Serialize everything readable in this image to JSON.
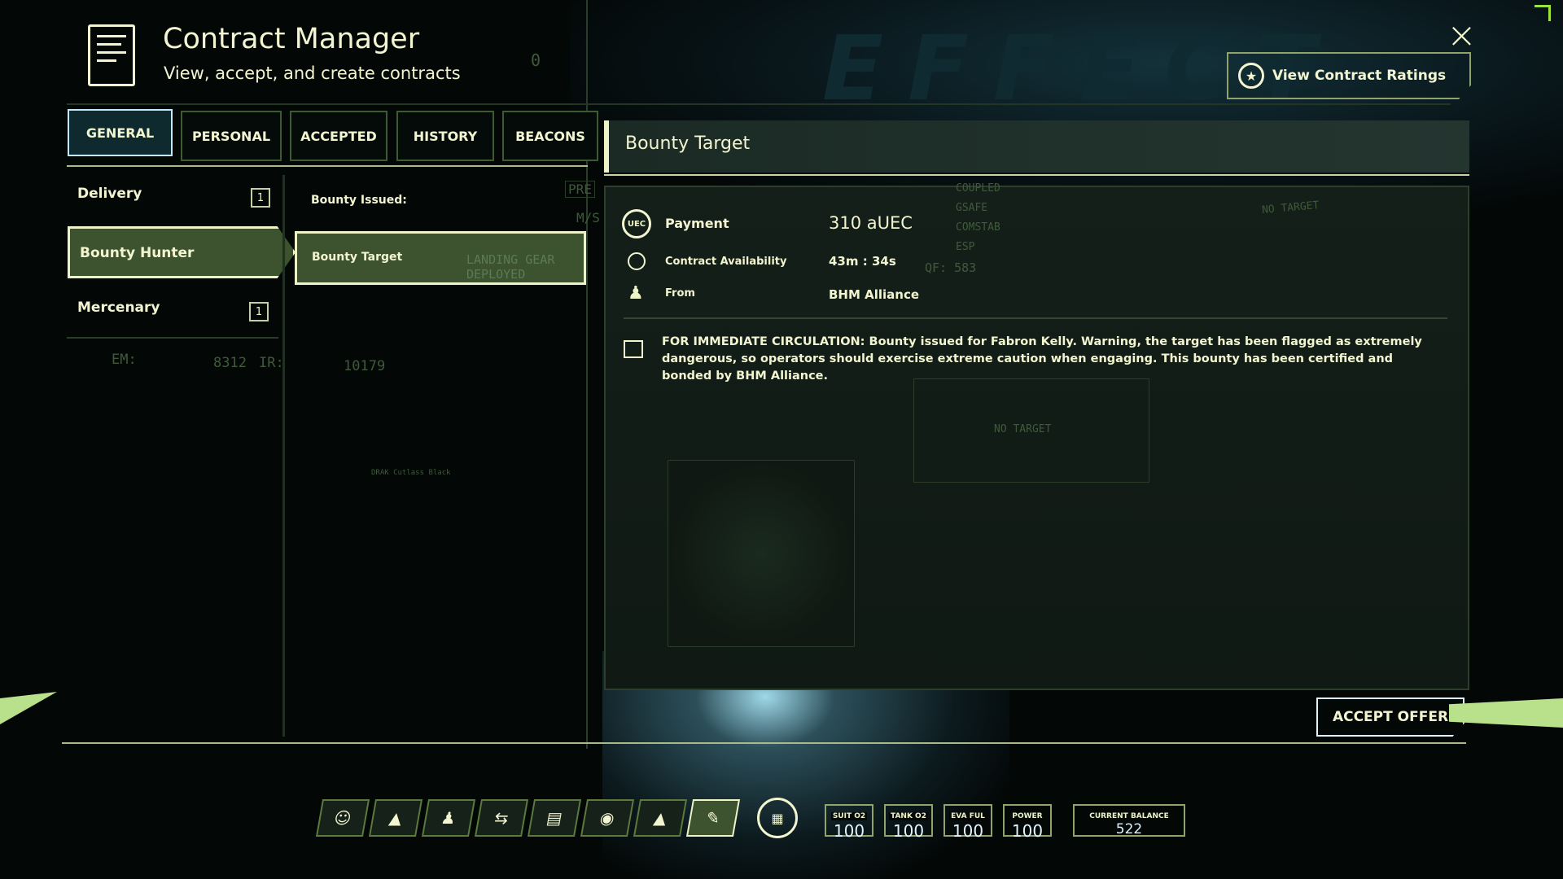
{
  "header": {
    "title": "Contract Manager",
    "subtitle": "View, accept, and create contracts",
    "icon": "contract-document-icon"
  },
  "tabs": [
    {
      "label": "GENERAL",
      "active": true
    },
    {
      "label": "PERSONAL"
    },
    {
      "label": "ACCEPTED"
    },
    {
      "label": "HISTORY"
    },
    {
      "label": "BEACONS"
    }
  ],
  "categories": [
    {
      "label": "Delivery",
      "count": "1"
    },
    {
      "label": "Bounty Hunter",
      "selected": true
    },
    {
      "label": "Mercenary",
      "count": "1"
    }
  ],
  "contracts": {
    "section": "Bounty Issued:",
    "items": [
      {
        "label": "Bounty Target",
        "selected": true
      }
    ]
  },
  "detail": {
    "title": "Bounty Target",
    "payment_label": "Payment",
    "payment_value": "310 aUEC",
    "payment_icon": "UEC",
    "availability_label": "Contract Availability",
    "availability_value": "43m : 34s",
    "from_label": "From",
    "from_value": "BHM Alliance",
    "description": "FOR IMMEDIATE CIRCULATION: Bounty issued for Fabron Kelly. Warning, the target has been flagged as extremely dangerous, so operators should exercise extreme caution when engaging. This bounty has been certified and bonded by BHM Alliance."
  },
  "actions": {
    "ratings": "View Contract Ratings",
    "accept": "ACCEPT OFFER",
    "close": "×"
  },
  "hud_background": {
    "em_label": "EM:",
    "em": "8312",
    "ir_label": "IR:",
    "ir": "10179",
    "landing": "LANDING GEAR DEPLOYED",
    "pre": "PRE",
    "ms": "M/S",
    "coupled": "COUPLED",
    "gsafe": "GSAFE",
    "comstab": "COMSTAB",
    "esp": "ESP",
    "qf": "QF: 583",
    "no_target": "NO TARGET",
    "ship": "DRAK Cutlass Black",
    "zero": "0"
  },
  "status_bar": {
    "icons": [
      "emote-icon",
      "ship-icon",
      "person-icon",
      "transfer-icon",
      "inventory-icon",
      "camera-icon",
      "fire-icon",
      "contracts-icon"
    ],
    "stats": [
      {
        "label": "SUIT O2",
        "value": "100"
      },
      {
        "label": "TANK O2",
        "value": "100"
      },
      {
        "label": "EVA FUL",
        "value": "100"
      },
      {
        "label": "POWER",
        "value": "100"
      }
    ],
    "balance_label": "CURRENT BALANCE",
    "balance": "522"
  },
  "colors": {
    "accent": "#eef3c8",
    "panel": "#141f19",
    "selected": "#3d5330",
    "hud_green": "#9be33f"
  }
}
